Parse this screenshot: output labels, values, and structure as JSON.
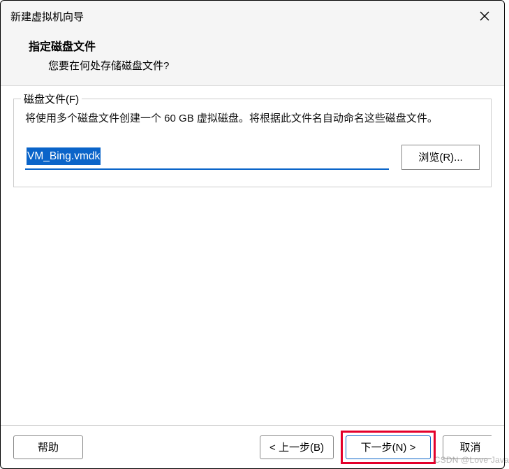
{
  "titlebar": {
    "title": "新建虚拟机向导"
  },
  "header": {
    "title": "指定磁盘文件",
    "subtitle": "您要在何处存储磁盘文件?"
  },
  "fieldset": {
    "legend": "磁盘文件(F)",
    "description": "将使用多个磁盘文件创建一个 60 GB 虚拟磁盘。将根据此文件名自动命名这些磁盘文件。",
    "file_value": "VM_Bing.vmdk",
    "browse_label": "浏览(R)..."
  },
  "footer": {
    "help_label": "帮助",
    "back_label": "< 上一步(B)",
    "next_label": "下一步(N) >",
    "cancel_label": "取消"
  },
  "watermark": "CSDN @Love Java"
}
